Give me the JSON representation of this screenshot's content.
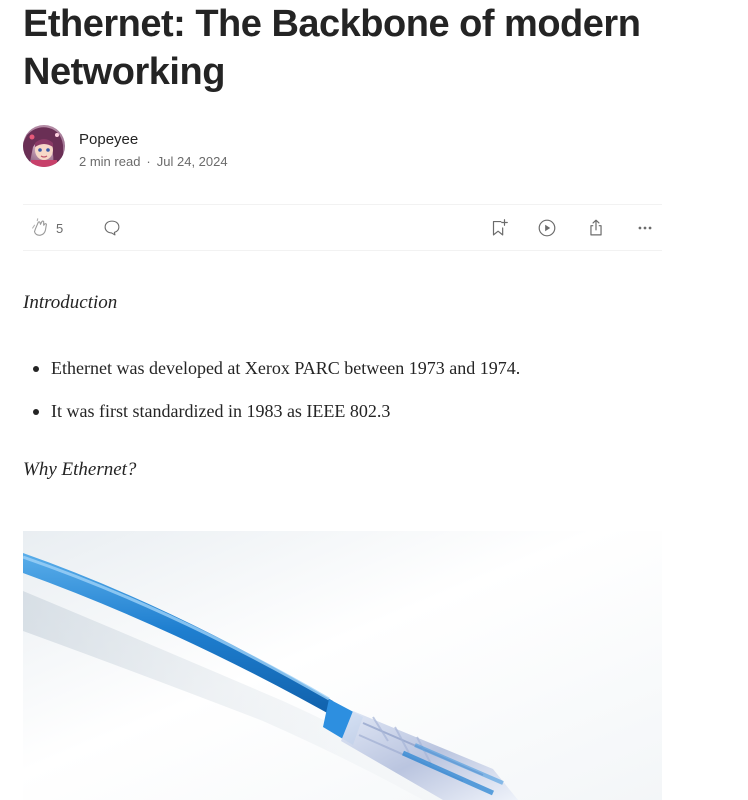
{
  "article": {
    "title": "Ethernet: The Backbone of modern Networking"
  },
  "author": {
    "name": "Popeyee",
    "read_time": "2 min read",
    "separator": "·",
    "date": "Jul 24, 2024"
  },
  "actions": {
    "clap_count": "5",
    "icons": [
      "clap-icon",
      "comment-icon",
      "bookmark-add-icon",
      "play-icon",
      "share-icon",
      "more-icon"
    ]
  },
  "content": {
    "intro_heading": "Introduction",
    "bullets": [
      "Ethernet was developed at Xerox PARC between 1973 and 1974.",
      "It was first standardized in 1983 as IEEE 802.3"
    ],
    "why_heading": "Why Ethernet?"
  },
  "colors": {
    "text": "#242424",
    "muted": "#6b6b6b",
    "divider": "#f2f2f2",
    "cable_blue": "#2b86d4"
  }
}
